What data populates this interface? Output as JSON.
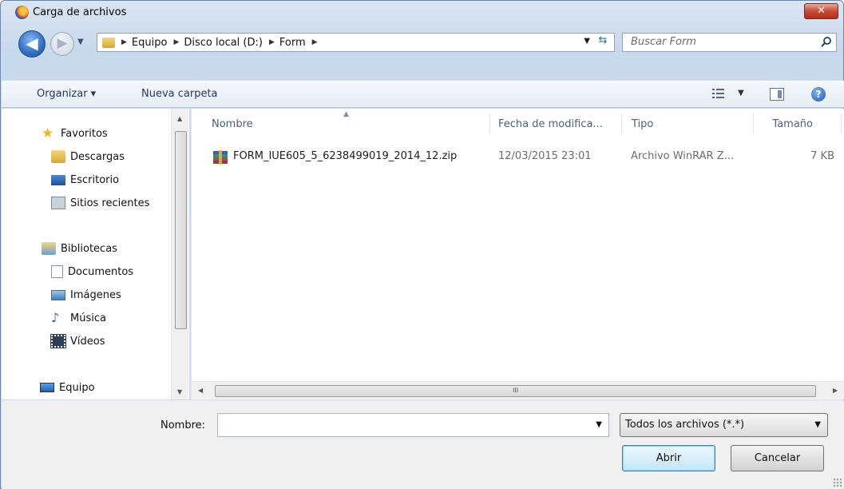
{
  "window": {
    "title": "Carga de archivos",
    "close_label": "✕"
  },
  "nav": {
    "back_glyph": "◀",
    "forward_glyph": "▶",
    "breadcrumb": [
      "Equipo",
      "Disco local (D:)",
      "Form"
    ],
    "search_placeholder": "Buscar Form"
  },
  "toolbar": {
    "organize_label": "Organizar ▾",
    "new_folder_label": "Nueva carpeta"
  },
  "sidebar": {
    "favorites_label": "Favoritos",
    "favorites": [
      "Descargas",
      "Escritorio",
      "Sitios recientes"
    ],
    "libraries_label": "Bibliotecas",
    "libraries": [
      "Documentos",
      "Imágenes",
      "Música",
      "Vídeos"
    ],
    "computer_label": "Equipo"
  },
  "list": {
    "columns": [
      "Nombre",
      "Fecha de modifica...",
      "Tipo",
      "Tamaño"
    ],
    "files": [
      {
        "name": "FORM_IUE605_5_6238499019_2014_12.zip",
        "date": "12/03/2015 23:01",
        "type": "Archivo WinRAR Z...",
        "size": "7 KB"
      }
    ],
    "hscroll_grip": "III"
  },
  "footer": {
    "name_label": "Nombre:",
    "name_value": "",
    "filter_value": "Todos los archivos (*.*)",
    "open_label": "Abrir",
    "cancel_label": "Cancelar"
  },
  "colors": {
    "accent": "#2f6fc3",
    "close": "#c74a35",
    "header_text": "#4c607a"
  }
}
